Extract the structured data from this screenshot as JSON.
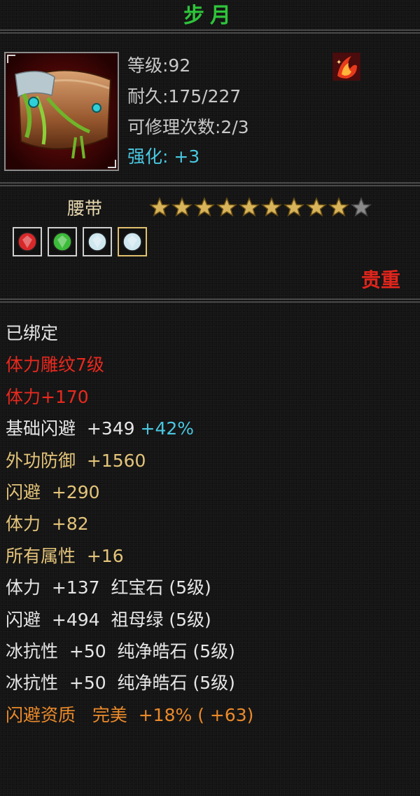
{
  "item": {
    "name": "步月",
    "level_line": "等级:92",
    "durability_line": "耐久:175/227",
    "repair_line": "可修理次数:2/3",
    "enhance_line": "强化:  +3",
    "type": "腰带",
    "stars_filled": 9,
    "stars_total": 10,
    "rarity": "贵重"
  },
  "gems": [
    {
      "icon": "ruby-gem-icon",
      "color": "#d8282a"
    },
    {
      "icon": "emerald-gem-icon",
      "color": "#3dbb3a"
    },
    {
      "icon": "diamond-gem-icon",
      "color": "#cfe7ef"
    },
    {
      "icon": "diamond-gem-icon",
      "color": "#cfe7ef"
    }
  ],
  "attributes": {
    "bound": "已绑定",
    "carving": "体力雕纹7级",
    "carving_stat": "体力+170",
    "base_dodge_label": "基础闪避  +349",
    "base_dodge_pct": "+42%",
    "ext_defense": "外功防御  +1560",
    "dodge": "闪避  +290",
    "stamina": "体力  +82",
    "all_attr": "所有属性  +16",
    "gem1": "体力  +137  红宝石 (5级)",
    "gem2": "闪避  +494  祖母绿 (5级)",
    "gem3": "冰抗性  +50  纯净皓石 (5级)",
    "gem4": "冰抗性  +50  纯净皓石 (5级)",
    "aptitude": "闪避资质   完美  +18% ( +63)"
  },
  "colors": {
    "title": "#2ec53a",
    "white": "#e6e6e6",
    "red": "#e8291e",
    "gold": "#e3c47a",
    "cyan": "#49c7e0",
    "orange": "#eb8a2a"
  }
}
